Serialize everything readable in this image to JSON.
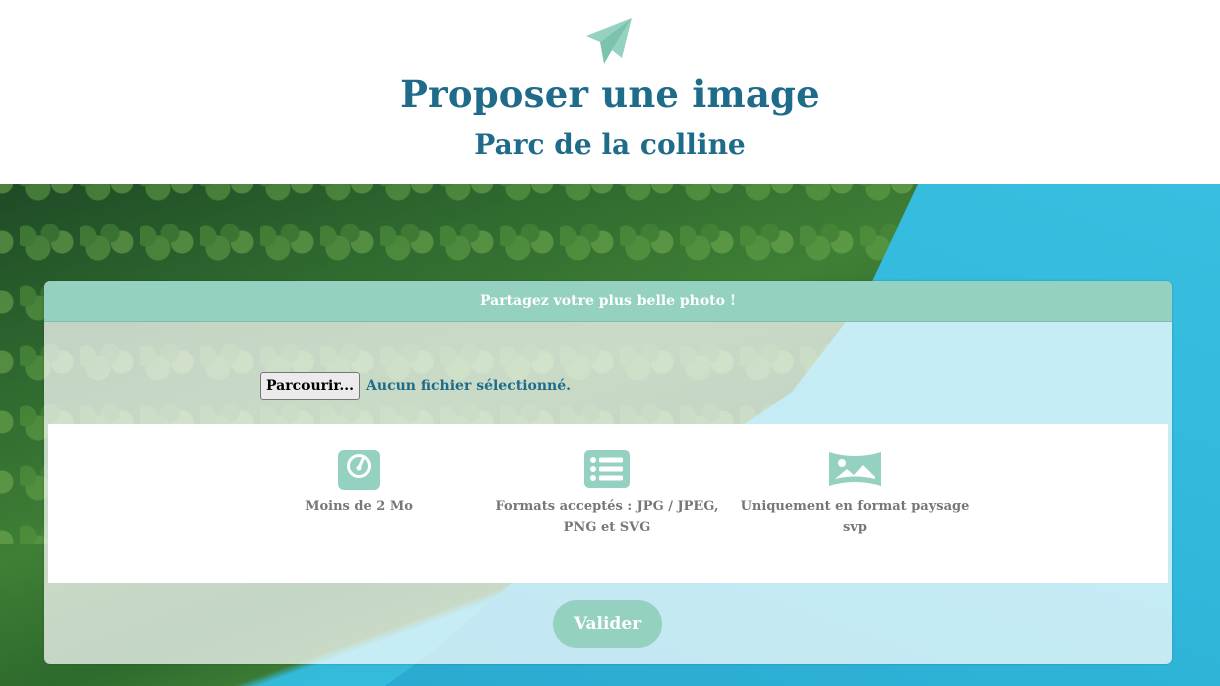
{
  "header": {
    "title": "Proposer une image",
    "subtitle": "Parc de la colline",
    "icon": "paper-plane-icon"
  },
  "card": {
    "heading": "Partagez votre plus belle photo !",
    "file_input": {
      "button_label": "Parcourir...",
      "status": "Aucun fichier sélectionné."
    },
    "requirements": [
      {
        "icon": "scale-icon",
        "label": "Moins de 2 Mo"
      },
      {
        "icon": "list-icon",
        "label": "Formats acceptés : JPG / JPEG, PNG et SVG"
      },
      {
        "icon": "landscape-image-icon",
        "label": "Uniquement en format paysage svp"
      }
    ],
    "submit_label": "Valider"
  },
  "colors": {
    "accent": "#94d1c0",
    "title": "#1f6b8a",
    "muted_text": "#777777"
  }
}
